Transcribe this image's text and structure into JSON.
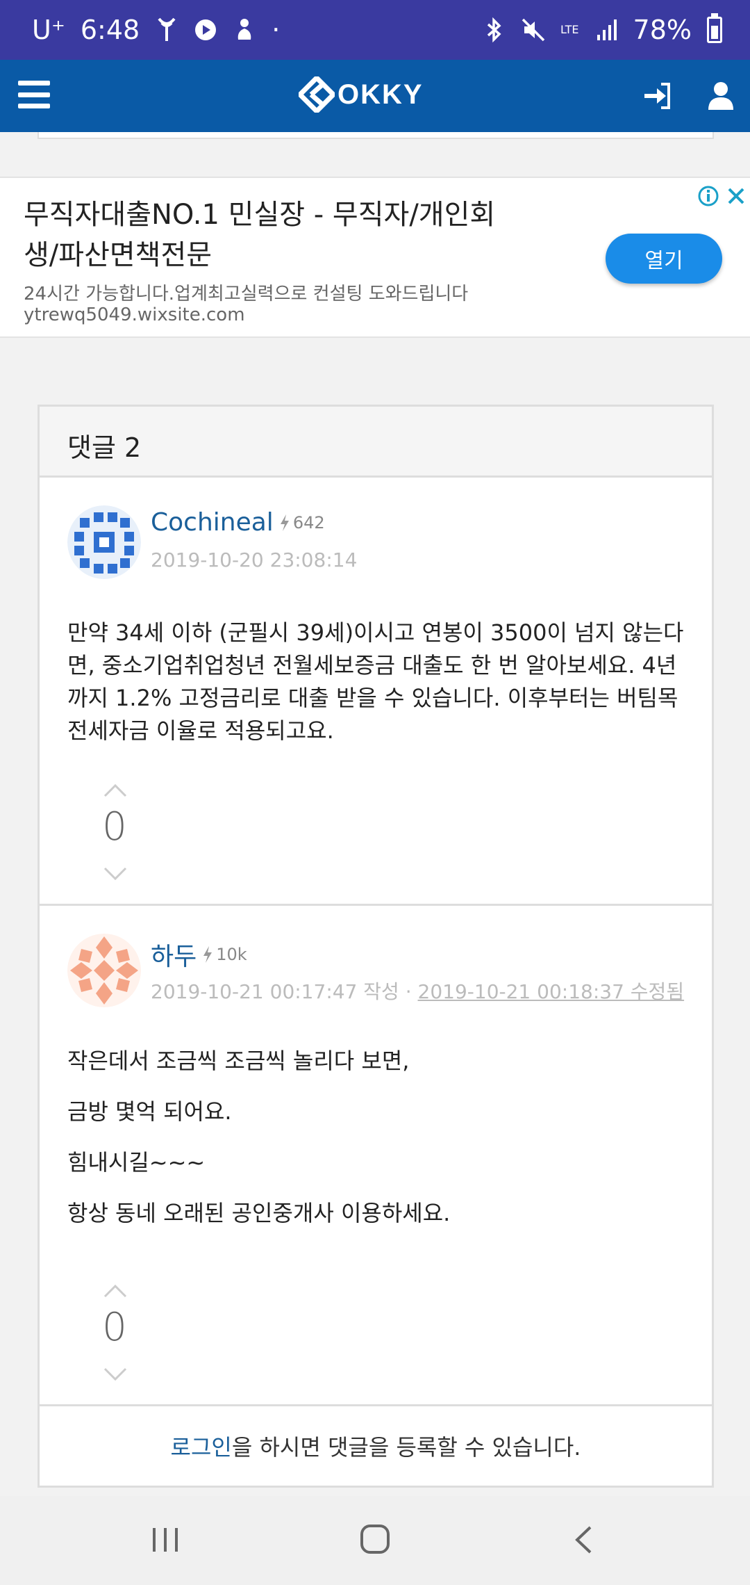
{
  "status_bar": {
    "carrier": "U⁺",
    "time": "6:48",
    "dot": "·",
    "network": "LTE",
    "battery": "78%"
  },
  "header": {
    "logo_text": "OKKY"
  },
  "ad": {
    "title": "무직자대출NO.1 민실장 - 무직자/개인회생/파산면책전문",
    "description": "24시간 가능합니다.업계최고실력으로 컨설팅 도와드립니다",
    "url": "ytrewq5049.wixsite.com",
    "button_label": "열기"
  },
  "comments": {
    "heading": "댓글 2",
    "items": [
      {
        "author": "Cochineal",
        "score": "642",
        "date": "2019-10-20 23:08:14",
        "body": [
          "만약 34세 이하 (군필시 39세)이시고 연봉이 3500이 넘지 않는다면, 중소기업취업청년 전월세보증금 대출도 한 번 알아보세요. 4년까지  1.2% 고정금리로 대출 받을 수 있습니다. 이후부터는 버팀목 전세자금 이율로 적용되고요."
        ],
        "votes": "0"
      },
      {
        "author": "하두",
        "score": "10k",
        "date": "2019-10-21 00:17:47 작성",
        "separator": " · ",
        "edited": "2019-10-21 00:18:37 수정됨",
        "body": [
          "작은데서 조금씩 조금씩 놀리다 보면,",
          "금방 몇억 되어요.",
          "힘내시길~~~",
          "항상 동네 오래된 공인중개사 이용하세요."
        ],
        "votes": "0"
      }
    ],
    "login_note": {
      "link": "로그인",
      "text": "을 하시면 댓글을 등록할 수 있습니다."
    }
  },
  "colors": {
    "status_bar": "#3a3aa0",
    "app_bar": "#0a5aa6",
    "link": "#1a5f9a",
    "ad_button": "#1a8ce8"
  }
}
